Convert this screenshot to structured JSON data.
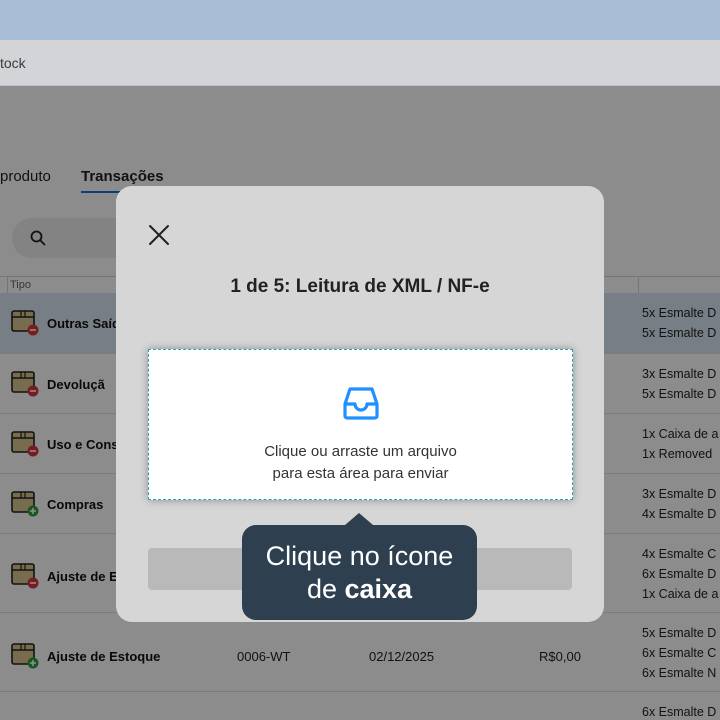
{
  "browser": {
    "url_fragment": "tock"
  },
  "app": {
    "tabs": [
      {
        "label": "produto"
      },
      {
        "label": "Transações"
      }
    ],
    "table": {
      "headers": {
        "tipo": "Tipo"
      },
      "rows": [
        {
          "name": "Outras Saíd",
          "status": "minus",
          "items": [
            "5x Esmalte D",
            "5x Esmalte D"
          ]
        },
        {
          "name": "Devoluçã",
          "status": "minus",
          "items": [
            "3x Esmalte D",
            "5x Esmalte D"
          ]
        },
        {
          "name": "Uso e Cons",
          "status": "minus",
          "items": [
            "1x Caixa de a",
            "1x Removed"
          ]
        },
        {
          "name": "Compras",
          "status": "plus",
          "items": [
            "3x Esmalte D",
            "4x Esmalte D"
          ]
        },
        {
          "name": "Ajuste de E",
          "status": "minus",
          "items": [
            "4x Esmalte C",
            "6x Esmalte D",
            "1x Caixa de a"
          ]
        },
        {
          "name": "Ajuste de Estoque",
          "status": "plus",
          "code": "0006-WT",
          "date": "02/12/2025",
          "value": "R$0,00",
          "items": [
            "5x Esmalte D",
            "6x Esmalte C",
            "6x Esmalte N"
          ]
        },
        {
          "name": "",
          "status": "none",
          "items": [
            "6x Esmalte D"
          ]
        }
      ]
    }
  },
  "modal": {
    "title": "1 de 5: Leitura de XML / NF-e",
    "dropzone": {
      "line1": "Clique ou arraste um arquivo",
      "line2": "para esta área para enviar"
    }
  },
  "tooltip": {
    "line1": "Clique no ícone",
    "line2_prefix": "de ",
    "line2_bold": "caixa"
  },
  "colors": {
    "accent": "#1a6fd6",
    "dropzone_icon": "#1e90ff",
    "tooltip_bg": "#2e3f4f",
    "badge_minus": "#d9363e",
    "badge_plus": "#2e9e3f"
  }
}
